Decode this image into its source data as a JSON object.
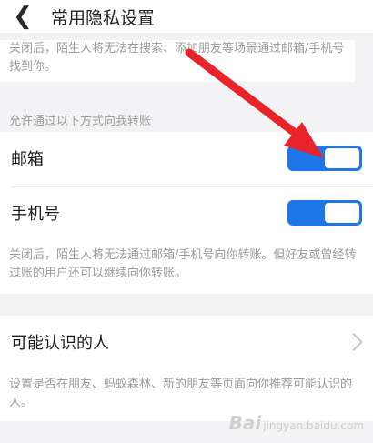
{
  "header": {
    "back_icon": "chevron-left-icon",
    "title": "常用隐私设置"
  },
  "notes": {
    "top": "关闭后，陌生人将无法在搜索、添加朋友等场景通过邮箱/手机号找到你。",
    "transfer": "关闭后，陌生人将无法通过邮箱/手机号向你转账。但好友或曾经转过账的用户还可以继续向你转账。",
    "recommend": "设置是否在朋友、蚂蚁森林、新的朋友等页面向你推荐可能认识的人。"
  },
  "section_label": "允许通过以下方式向我转账",
  "transfer_options": [
    {
      "label": "邮箱",
      "enabled": true
    },
    {
      "label": "手机号",
      "enabled": true
    }
  ],
  "people_row": {
    "label": "可能认识的人",
    "icon": "chevron-right-icon"
  },
  "annotation": {
    "arrow_color": "#e8232a"
  },
  "watermark": {
    "text": "Bai",
    "suffix": "jingyan.baidu.com"
  }
}
